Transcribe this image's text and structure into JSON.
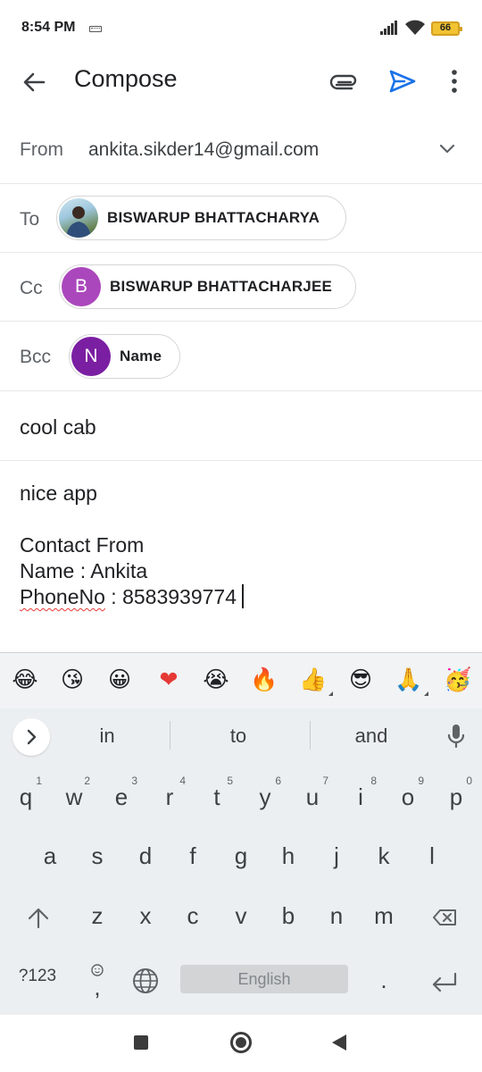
{
  "status_bar": {
    "time": "8:54 PM",
    "battery": "66"
  },
  "app_bar": {
    "title": "Compose"
  },
  "from": {
    "label": "From",
    "value": "ankita.sikder14@gmail.com"
  },
  "to": {
    "label": "To",
    "chip_name": "BISWARUP BHATTACHARYA"
  },
  "cc": {
    "label": "Cc",
    "chip_initial": "B",
    "chip_name": "BISWARUP BHATTACHARJEE",
    "avatar_color": "#ab47bc"
  },
  "bcc": {
    "label": "Bcc",
    "chip_initial": "N",
    "chip_name": "Name",
    "avatar_color": "#7b1fa2"
  },
  "subject": "cool cab",
  "body": {
    "line1": "nice app",
    "line2": "Contact From",
    "line3": "Name : Ankita",
    "line4_spell": "PhoneNo",
    "line4_rest": " : 8583939774"
  },
  "keyboard": {
    "emojis": [
      "😂",
      "😘",
      "😀",
      "❤",
      "😭",
      "🔥",
      "👍",
      "😎",
      "🙏",
      "🥳"
    ],
    "suggestions": [
      "in",
      "to",
      "and"
    ],
    "row1": [
      "q",
      "w",
      "e",
      "r",
      "t",
      "y",
      "u",
      "i",
      "o",
      "p"
    ],
    "row1_nums": [
      "1",
      "2",
      "3",
      "4",
      "5",
      "6",
      "7",
      "8",
      "9",
      "0"
    ],
    "row2": [
      "a",
      "s",
      "d",
      "f",
      "g",
      "h",
      "j",
      "k",
      "l"
    ],
    "row3": [
      "z",
      "x",
      "c",
      "v",
      "b",
      "n",
      "m"
    ],
    "symbols_key": "?123",
    "comma_key": ",",
    "space_label": "English",
    "period_key": "."
  },
  "colors": {
    "send_accent": "#1a73e8",
    "spell_error": "#e53935"
  }
}
